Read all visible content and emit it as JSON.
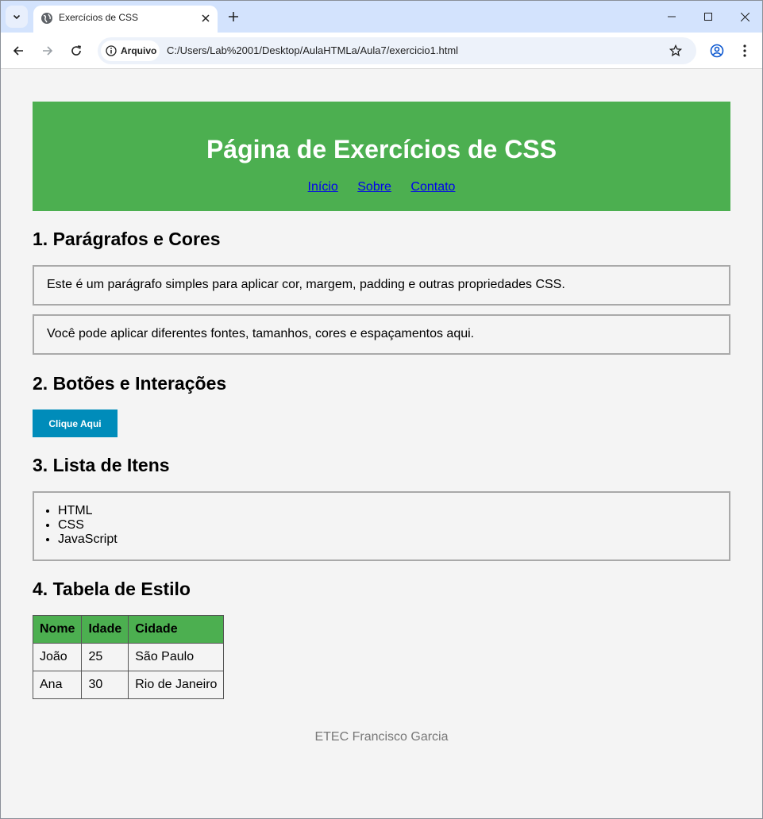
{
  "browser": {
    "tab_title": "Exercícios de CSS",
    "security_chip": "Arquivo",
    "url": "C:/Users/Lab%2001/Desktop/AulaHTMLa/Aula7/exercicio1.html"
  },
  "header": {
    "title": "Página de Exercícios de CSS",
    "nav": [
      "Início",
      "Sobre",
      "Contato"
    ]
  },
  "sections": {
    "paragraphs": {
      "heading": "1. Parágrafos e Cores",
      "p1": "Este é um parágrafo simples para aplicar cor, margem, padding e outras propriedades CSS.",
      "p2": "Você pode aplicar diferentes fontes, tamanhos, cores e espaçamentos aqui."
    },
    "buttons": {
      "heading": "2. Botões e Interações",
      "button_label": "Clique Aqui"
    },
    "list": {
      "heading": "3. Lista de Itens",
      "items": [
        "HTML",
        "CSS",
        "JavaScript"
      ]
    },
    "table": {
      "heading": "4. Tabela de Estilo",
      "columns": [
        "Nome",
        "Idade",
        "Cidade"
      ],
      "rows": [
        [
          "João",
          "25",
          "São Paulo"
        ],
        [
          "Ana",
          "30",
          "Rio de Janeiro"
        ]
      ]
    }
  },
  "footer": "ETEC Francisco Garcia",
  "colors": {
    "header_bg": "#4caf50",
    "button_bg": "#008cba",
    "page_bg": "#f4f4f4"
  }
}
